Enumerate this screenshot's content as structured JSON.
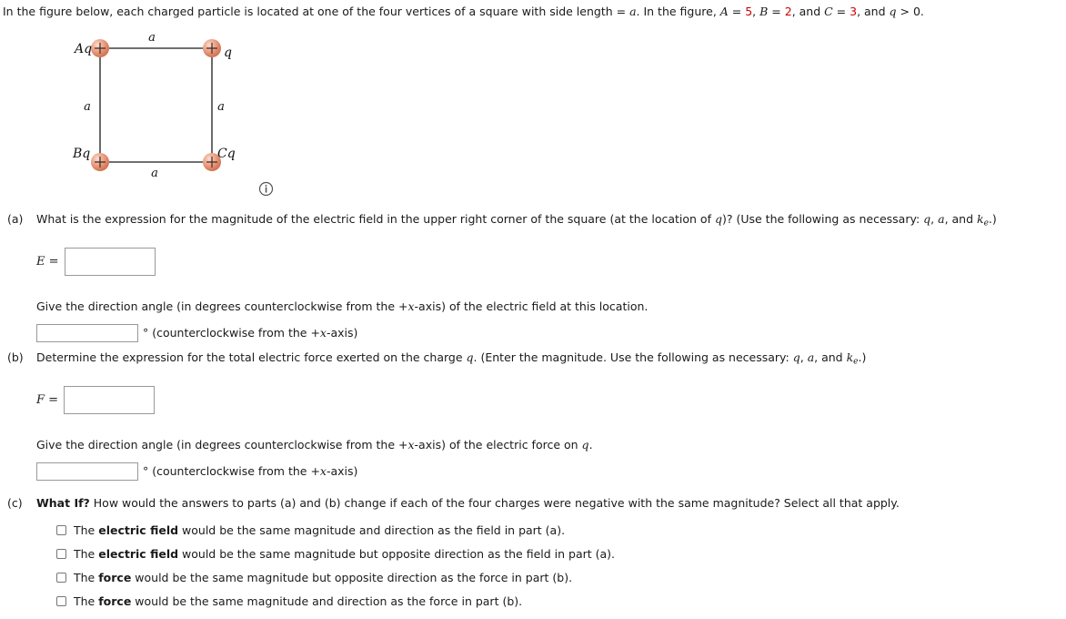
{
  "intro": {
    "text_part1": "In the figure below, each charged particle is located at one of the four vertices of a square with side length = ",
    "side_symbol": "a",
    "text_part2": ". In the figure, ",
    "A_symbol": "A",
    "A_eq": " = ",
    "A_value": "5",
    "sep1": ", ",
    "B_symbol": "B",
    "B_eq": " = ",
    "B_value": "2",
    "sep2": ", and ",
    "C_symbol": "C",
    "C_eq": " = ",
    "C_value": "3",
    "tail": ", and ",
    "q_symbol": "q",
    "condition": " > 0."
  },
  "figure": {
    "label_top_left": "Aq",
    "label_top_right": "q",
    "label_bottom_left": "Bq",
    "label_bottom_right": "Cq",
    "side_top": "a",
    "side_left": "a",
    "side_right": "a",
    "side_bottom": "a",
    "charge_sign": "+",
    "charge_color": "#e08060",
    "charge_highlight": "#f6c4b0",
    "line_color": "#1a1a1a",
    "info_icon": "info-icon",
    "info_glyph": "i"
  },
  "parts": [
    {
      "label": "(a)",
      "question_a": "What is the expression for the magnitude of the electric field in the upper right corner of the square (at the location of ",
      "question_q": "q",
      "question_b": ")? (Use the following as necessary: ",
      "var_q": "q",
      "var_sep1": ", ",
      "var_a": "a",
      "var_sep2": ", and ",
      "var_k": "k",
      "var_k_sub": "e",
      "question_tail": ".)",
      "answer_label": "E =",
      "answer_value": "",
      "answer_placeholder": "",
      "direction_prompt_1": "Give the direction angle (in degrees counterclockwise from the +",
      "direction_prompt_x": "x",
      "direction_prompt_2": "-axis) of the electric field at this location.",
      "angle_value": "",
      "angle_unit_1": "° (counterclockwise from the +",
      "angle_unit_x": "x",
      "angle_unit_2": "-axis)"
    },
    {
      "label": "(b)",
      "question_a": "Determine the expression for the total electric force exerted on the charge ",
      "question_q": "q",
      "question_b": ". (Enter the magnitude. Use the following as necessary: ",
      "var_q": "q",
      "var_sep1": ", ",
      "var_a": "a",
      "var_sep2": ", and ",
      "var_k": "k",
      "var_k_sub": "e",
      "question_tail": ".)",
      "answer_label": "F =",
      "answer_value": "",
      "answer_placeholder": "",
      "direction_prompt_1": "Give the direction angle (in degrees counterclockwise from the +",
      "direction_prompt_x": "x",
      "direction_prompt_2": "-axis) of the electric force on ",
      "direction_prompt_q": "q",
      "direction_prompt_3": ".",
      "angle_value": "",
      "angle_unit_1": "° (counterclockwise from the +",
      "angle_unit_x": "x",
      "angle_unit_2": "-axis)"
    }
  ],
  "part_c": {
    "label": "(c)",
    "what_if": "What If?",
    "question": " How would the answers to parts (a) and (b) change if each of the four charges were negative with the same magnitude? Select all that apply.",
    "options": [
      {
        "pre": "The ",
        "bold": "electric field",
        "post": " would be the same magnitude and direction as the field in part (a).",
        "checked": false
      },
      {
        "pre": "The ",
        "bold": "electric field",
        "post": " would be the same magnitude but opposite direction as the field in part (a).",
        "checked": false
      },
      {
        "pre": "The ",
        "bold": "force",
        "post": " would be the same magnitude but opposite direction as the force in part (b).",
        "checked": false
      },
      {
        "pre": "The ",
        "bold": "force",
        "post": " would be the same magnitude and direction as the force in part (b).",
        "checked": false
      }
    ]
  }
}
